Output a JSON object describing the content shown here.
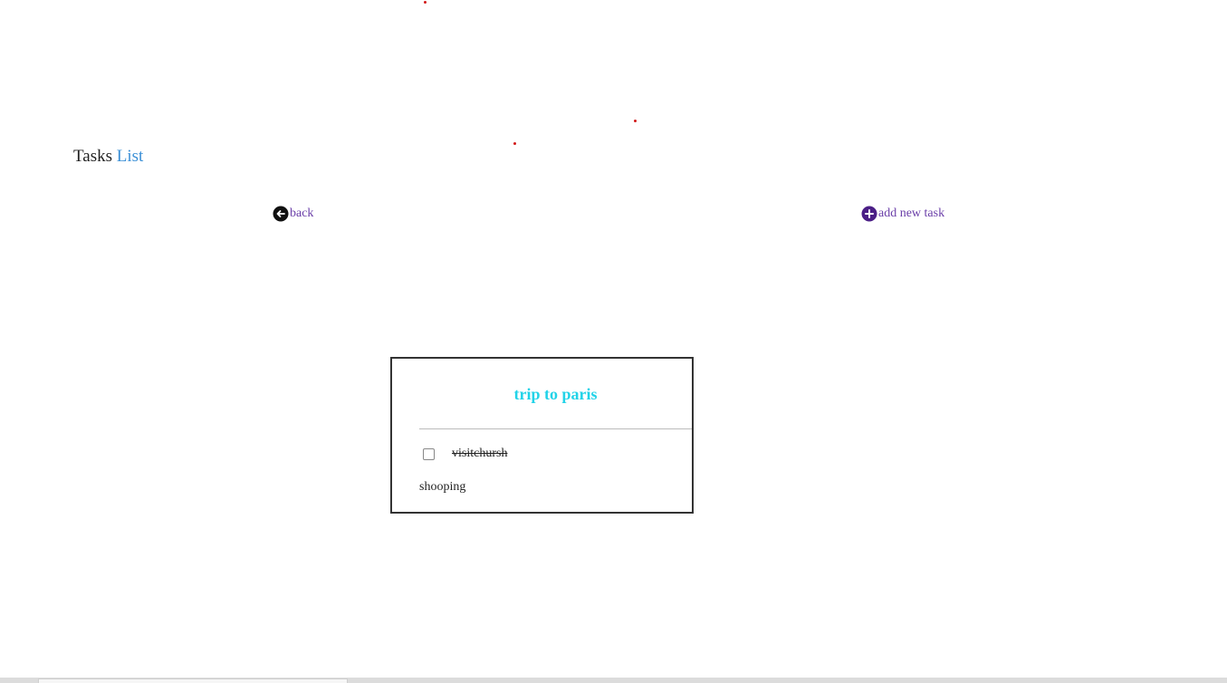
{
  "header": {
    "title_part1": "Tasks",
    "title_part2": "List"
  },
  "nav": {
    "back_label": "back",
    "back_icon": "arrow-left-circle-icon",
    "add_label": "add new task",
    "add_icon": "plus-circle-icon"
  },
  "card": {
    "title": "trip to paris",
    "tasks": [
      {
        "label": "visitchursh",
        "checked": false,
        "completed": true
      }
    ],
    "items": [
      {
        "label": "shooping"
      }
    ]
  },
  "colors": {
    "accent_blue": "#3a8fd6",
    "link_purple": "#6a3ea8",
    "card_title_cyan": "#22d3e8",
    "dot_red": "#d21a1a"
  }
}
